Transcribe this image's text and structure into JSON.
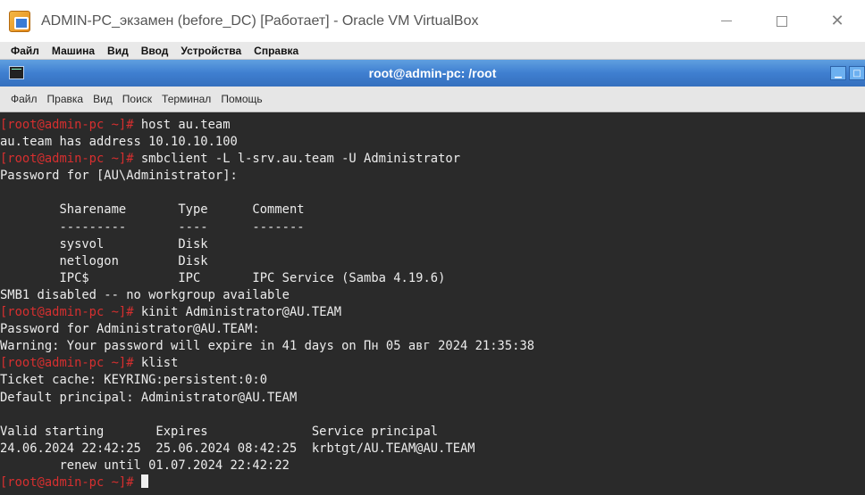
{
  "host_window": {
    "title": "ADMIN-PC_экзамен (before_DC) [Работает] - Oracle VM VirtualBox",
    "icon": "virtualbox-icon",
    "controls": {
      "minimize": "—",
      "maximize": "☐",
      "close": "✕"
    }
  },
  "vbox_menu": [
    "Файл",
    "Машина",
    "Вид",
    "Ввод",
    "Устройства",
    "Справка"
  ],
  "terminal_window": {
    "title": "root@admin-pc: /root",
    "menu": [
      "Файл",
      "Правка",
      "Вид",
      "Поиск",
      "Терминал",
      "Помощь"
    ]
  },
  "terminal": {
    "prompt": "[root@admin-pc ~]#",
    "lines": [
      {
        "prompt": true,
        "text": " host au.team"
      },
      {
        "prompt": false,
        "text": "au.team has address 10.10.10.100"
      },
      {
        "prompt": true,
        "text": " smbclient -L l-srv.au.team -U Administrator"
      },
      {
        "prompt": false,
        "text": "Password for [AU\\Administrator]:"
      },
      {
        "prompt": false,
        "text": ""
      },
      {
        "prompt": false,
        "text": "        Sharename       Type      Comment"
      },
      {
        "prompt": false,
        "text": "        ---------       ----      -------"
      },
      {
        "prompt": false,
        "text": "        sysvol          Disk"
      },
      {
        "prompt": false,
        "text": "        netlogon        Disk"
      },
      {
        "prompt": false,
        "text": "        IPC$            IPC       IPC Service (Samba 4.19.6)"
      },
      {
        "prompt": false,
        "text": "SMB1 disabled -- no workgroup available"
      },
      {
        "prompt": true,
        "text": " kinit Administrator@AU.TEAM"
      },
      {
        "prompt": false,
        "text": "Password for Administrator@AU.TEAM:"
      },
      {
        "prompt": false,
        "text": "Warning: Your password will expire in 41 days on Пн 05 авг 2024 21:35:38"
      },
      {
        "prompt": true,
        "text": " klist"
      },
      {
        "prompt": false,
        "text": "Ticket cache: KEYRING:persistent:0:0"
      },
      {
        "prompt": false,
        "text": "Default principal: Administrator@AU.TEAM"
      },
      {
        "prompt": false,
        "text": ""
      },
      {
        "prompt": false,
        "text": "Valid starting       Expires              Service principal"
      },
      {
        "prompt": false,
        "text": "24.06.2024 22:42:25  25.06.2024 08:42:25  krbtgt/AU.TEAM@AU.TEAM"
      },
      {
        "prompt": false,
        "text": "        renew until 01.07.2024 22:42:22"
      },
      {
        "prompt": true,
        "text": " ",
        "cursor": true
      }
    ]
  }
}
